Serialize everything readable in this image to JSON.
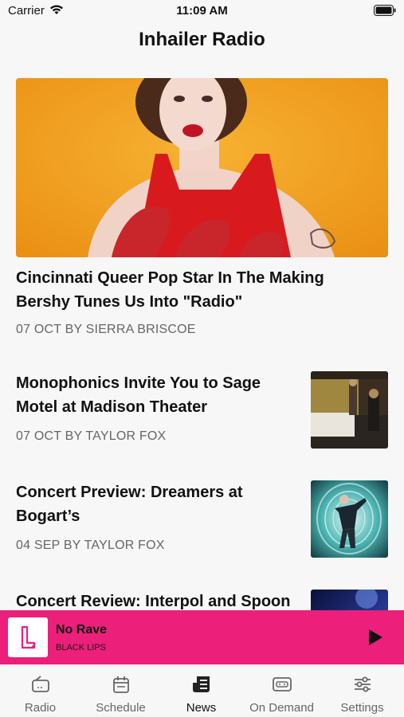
{
  "status_bar": {
    "carrier": "Carrier",
    "time": "11:09 AM"
  },
  "nav": {
    "title": "Inhailer Radio"
  },
  "featured": {
    "title": "Cincinnati Queer Pop Star In The Making Bershy Tunes Us Into \"Radio\"",
    "meta": "07 OCT BY SIERRA BRISCOE"
  },
  "articles": [
    {
      "title": "Monophonics Invite You to Sage Motel at Madison Theater",
      "meta": "07 OCT BY TAYLOR FOX"
    },
    {
      "title": "Concert Preview: Dreamers at Bogart’s",
      "meta": "04 SEP BY TAYLOR FOX"
    },
    {
      "title": "Concert Review: Interpol and Spoon",
      "meta": ""
    }
  ],
  "player": {
    "song": "No Rave",
    "artist": "BLACK LIPS"
  },
  "tabs": [
    {
      "label": "Radio",
      "icon": "radio-icon"
    },
    {
      "label": "Schedule",
      "icon": "calendar-icon"
    },
    {
      "label": "News",
      "icon": "news-icon",
      "active": true
    },
    {
      "label": "On Demand",
      "icon": "on-demand-icon"
    },
    {
      "label": "Settings",
      "icon": "settings-sliders-icon"
    }
  ],
  "colors": {
    "accent": "#ec1f7a",
    "background": "#f7f7f7"
  }
}
